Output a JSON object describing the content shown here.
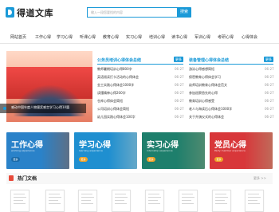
{
  "header": {
    "logo_text": "得道文库",
    "search_placeholder": "输入一段您要找的内容",
    "search_button": "搜索"
  },
  "nav": {
    "items": [
      "网站首页",
      "工作心得",
      "学习心得",
      "听课心得",
      "教育心得",
      "实习心得",
      "培训心得",
      "读书心得",
      "军训心得",
      "考研心得",
      "心得体会"
    ]
  },
  "banner": {
    "caption": "感动中国年度人物颁奖感言学习心得10篇"
  },
  "columns": [
    {
      "title": "公务员培训心得体会总结",
      "badge": "更多",
      "articles": [
        {
          "title": "教师暑期培训心得800字",
          "date": "06-27"
        },
        {
          "title": "英语阅读打卡活动的心得体会",
          "date": "06-27"
        },
        {
          "title": "金工实践心得体会1000字",
          "date": "06-27"
        },
        {
          "title": "读懂精神心得200字",
          "date": "06-27"
        },
        {
          "title": "仓库心得体会简短",
          "date": "06-27"
        },
        {
          "title": "公司培训心得体会简短",
          "date": "06-27"
        },
        {
          "title": "幼儿园实践心得体会100字",
          "date": "06-27"
        }
      ]
    },
    {
      "title": "装备管理心得体会总结",
      "badge": "更多",
      "articles": [
        {
          "title": "游泳心得感想简短",
          "date": "06-27"
        },
        {
          "title": "保密教育心得体会学习",
          "date": "06-27"
        },
        {
          "title": "幼师培训教育心得体会范文",
          "date": "06-27"
        },
        {
          "title": "参加巡察首先的心得",
          "date": "06-27"
        },
        {
          "title": "教育培训心得感受",
          "date": "06-27"
        },
        {
          "title": "老人与海读后心得体会1000字",
          "date": "06-27"
        },
        {
          "title": "关于升旗仪式的心得体会",
          "date": "06-27"
        }
      ]
    }
  ],
  "categories": [
    {
      "title": "工作心得",
      "subtitle": "working experience",
      "more": "更多",
      "color": "#2a82c9"
    },
    {
      "title": "学习心得",
      "subtitle": "learning experience",
      "more": "更多",
      "color": "#1f8fd0"
    },
    {
      "title": "实习心得",
      "subtitle": "internship experience",
      "more": "更多",
      "color": "#1e7f6c"
    },
    {
      "title": "党员心得",
      "subtitle": "Party member experience",
      "more": "更多",
      "color": "#d8373a"
    }
  ],
  "hot": {
    "title": "热门文档",
    "more": "更多 >>"
  }
}
